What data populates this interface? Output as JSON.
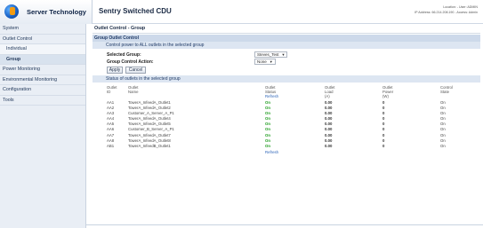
{
  "app": {
    "logo_text": "Server Technology",
    "title": "Sentry Switched CDU",
    "location_line": "Location: - User: ADMIN",
    "ip_line": "IP Address: 66.214.208.190 - Access: Admin"
  },
  "sidebar": {
    "items": [
      {
        "label": "System"
      },
      {
        "label": "Outlet Control"
      },
      {
        "label": "Individual"
      },
      {
        "label": "Group"
      },
      {
        "label": "Power Monitoring"
      },
      {
        "label": "Environmental Monitoring"
      },
      {
        "label": "Configuration"
      },
      {
        "label": "Tools"
      }
    ]
  },
  "main": {
    "breadcrumb": "Outlet Control - Group",
    "section_title": "Group Outlet Control",
    "control_subtitle": "Control power to ALL outlets in the selected group",
    "selected_group_label": "Selected Group:",
    "selected_group_value": "Steves_Test",
    "action_label": "Group Control Action:",
    "action_value": "None",
    "apply_label": "Apply",
    "cancel_label": "Cancel",
    "status_subtitle": "Status of outlets in the selected group"
  },
  "table": {
    "headers": [
      {
        "line1": "Outlet",
        "line2": "ID"
      },
      {
        "line1": "Outlet",
        "line2": "Name"
      },
      {
        "line1": "Outlet",
        "line2": "Status",
        "line3": "Refresh"
      },
      {
        "line1": "Outlet",
        "line2": "Load",
        "line3": "(A)"
      },
      {
        "line1": "Outlet",
        "line2": "Power",
        "line3": "(W)"
      },
      {
        "line1": "Control",
        "line2": "State"
      }
    ],
    "rows": [
      [
        "AA1",
        "TowerA_InfeedA_Outlet1",
        "On",
        "0.00",
        "0",
        "On"
      ],
      [
        "AA2",
        "TowerA_InfeedA_Outlet2",
        "On",
        "0.00",
        "0",
        "On"
      ],
      [
        "AA3",
        "Customer_A_Server_A_P1",
        "On",
        "0.00",
        "0",
        "On"
      ],
      [
        "AA4",
        "TowerA_InfeedA_Outlet4",
        "On",
        "0.00",
        "0",
        "On"
      ],
      [
        "AA5",
        "TowerA_InfeedA_Outlet5",
        "On",
        "0.00",
        "0",
        "On"
      ],
      [
        "AA6",
        "Customer_B_Server_A_P1",
        "On",
        "0.00",
        "0",
        "On"
      ],
      [
        "AA7",
        "TowerA_InfeedA_Outlet7",
        "On",
        "0.00",
        "0",
        "On"
      ],
      [
        "AA8",
        "TowerA_InfeedA_Outlet8",
        "On",
        "0.00",
        "0",
        "On"
      ],
      [
        "AB1",
        "TowerA_InfeedB_Outlet1",
        "On",
        "0.00",
        "0",
        "On"
      ]
    ],
    "refresh_label": "Refresh"
  },
  "colors": {
    "status_on": "#1a9a1a",
    "link": "#2a62b7",
    "section_bg": "#cdd9ea",
    "sidebar_bg": "#e9eef5"
  }
}
